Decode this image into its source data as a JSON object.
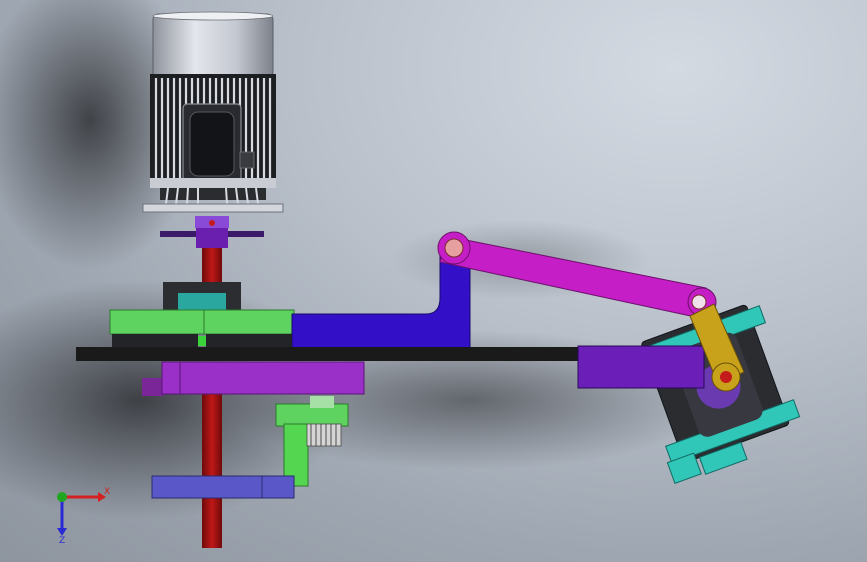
{
  "viewport": {
    "background_top": "#d4dae2",
    "background_bottom": "#8e959f"
  },
  "triad": {
    "x_label": "X",
    "z_label": "Z",
    "x_color": "#d42020",
    "y_color": "#1fa81f",
    "z_color": "#2a2ad4"
  },
  "parts": {
    "motor_color": "#c8ccd6",
    "shaft_color": "#9a1010",
    "coupling_color": "#6b1fae",
    "green_plate_color": "#5fd35f",
    "blue_link_color": "#3310c8",
    "violet_plate_color": "#9b30c8",
    "pink_rod_color": "#c61ec6",
    "yellow_crank_color": "#c8a21a",
    "teal_block_color": "#30c6b8",
    "base_bar_color": "#1a1a1a",
    "bottom_disk_color": "#5a58c8"
  }
}
